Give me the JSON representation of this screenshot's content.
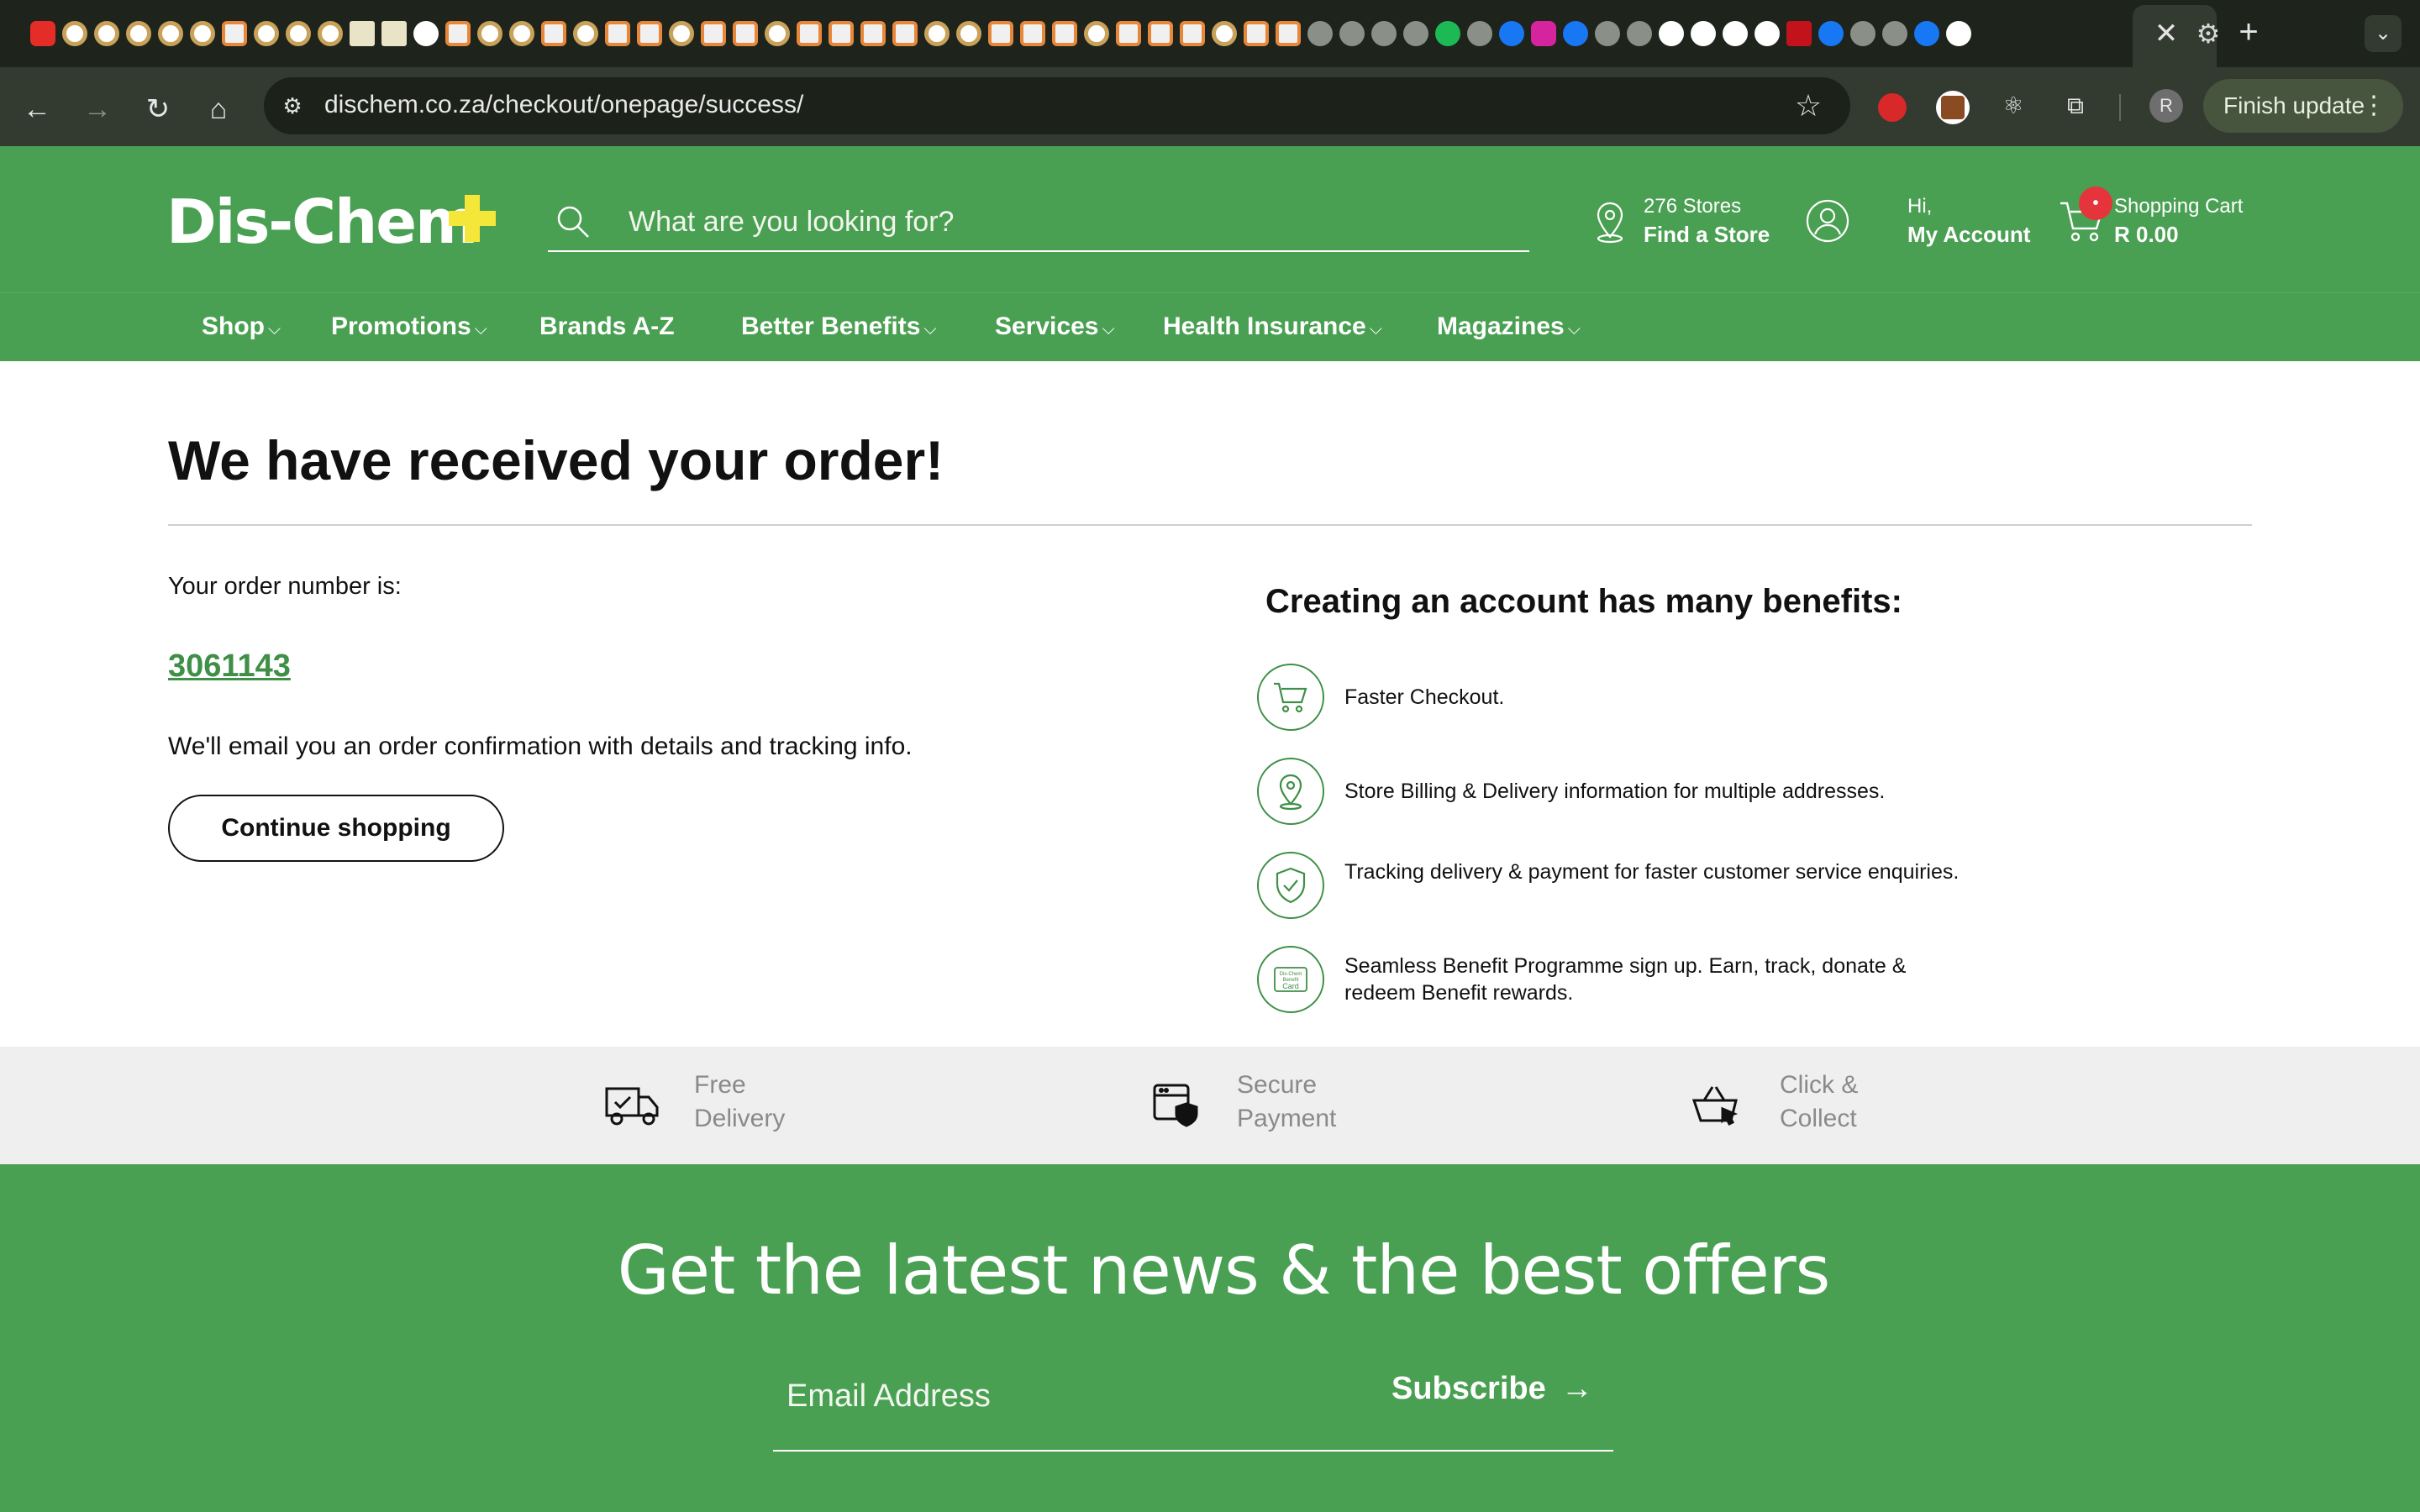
{
  "browser": {
    "url": "dischem.co.za/checkout/onepage/success/",
    "finish_update": "Finish update",
    "profile_initial": "R",
    "tab_favicons": [
      "youtube",
      "ring",
      "ring",
      "ring",
      "ring",
      "ring",
      "orange",
      "ring",
      "ring",
      "ring",
      "map",
      "map",
      "text",
      "orange",
      "ring",
      "ring",
      "orange",
      "ring",
      "orange",
      "orange",
      "ring",
      "orange",
      "orange",
      "ring",
      "orange",
      "orange",
      "orange",
      "orange",
      "ring",
      "ring",
      "orange",
      "orange",
      "orange",
      "ring",
      "orange",
      "orange",
      "orange",
      "ring",
      "orange",
      "orange",
      "grey",
      "grey",
      "grey",
      "grey",
      "green",
      "grey",
      "blue",
      "ig",
      "blue",
      "grey",
      "grey",
      "white",
      "white",
      "white",
      "white",
      "red",
      "blue",
      "grey",
      "grey",
      "blue",
      "white"
    ]
  },
  "header": {
    "logo": "Dis-Chem",
    "search_placeholder": "What are you looking for?",
    "stores_count": "276 Stores",
    "find_store": "Find a Store",
    "greeting": "Hi,",
    "account": "My Account",
    "cart_label": "Shopping Cart",
    "cart_total": "R 0.00",
    "cart_badge": "•"
  },
  "nav": {
    "items": [
      {
        "label": "Shop",
        "dropdown": true
      },
      {
        "label": "Promotions",
        "dropdown": true
      },
      {
        "label": "Brands A-Z",
        "dropdown": false
      },
      {
        "label": "Better Benefits",
        "dropdown": true
      },
      {
        "label": "Services",
        "dropdown": true
      },
      {
        "label": "Health Insurance",
        "dropdown": true
      },
      {
        "label": "Magazines",
        "dropdown": true
      }
    ]
  },
  "order": {
    "title": "We have received your order!",
    "number_label": "Your order number is:",
    "number": "3061143",
    "email_note": "We'll email you an order confirmation with details and tracking info.",
    "continue_label": "Continue shopping"
  },
  "benefits": {
    "title": "Creating an account has many benefits:",
    "items": [
      {
        "icon": "cart-icon",
        "text": "Faster Checkout."
      },
      {
        "icon": "location-pin-icon",
        "text": "Store Billing & Delivery information for multiple addresses."
      },
      {
        "icon": "shield-check-icon",
        "text": "Tracking delivery & payment for faster customer service enquiries."
      },
      {
        "icon": "benefit-card-icon",
        "text": "Seamless Benefit Programme sign up. Earn, track, donate & redeem Benefit rewards.",
        "card_lines": [
          "Dis-Chem",
          "Benefit",
          "Card"
        ]
      }
    ]
  },
  "perks": {
    "items": [
      {
        "icon": "delivery-truck-icon",
        "line1": "Free",
        "line2": "Delivery"
      },
      {
        "icon": "secure-payment-icon",
        "line1": "Secure",
        "line2": "Payment"
      },
      {
        "icon": "click-collect-basket-icon",
        "line1": "Click &",
        "line2": "Collect"
      }
    ]
  },
  "newsletter": {
    "title": "Get the latest news & the best offers",
    "email_placeholder": "Email Address",
    "subscribe_label": "Subscribe"
  },
  "colors": {
    "brand_green": "#4aa052",
    "order_link": "#3f8f47",
    "logo_plus": "#f5e63a",
    "badge_red": "#e5343b"
  }
}
